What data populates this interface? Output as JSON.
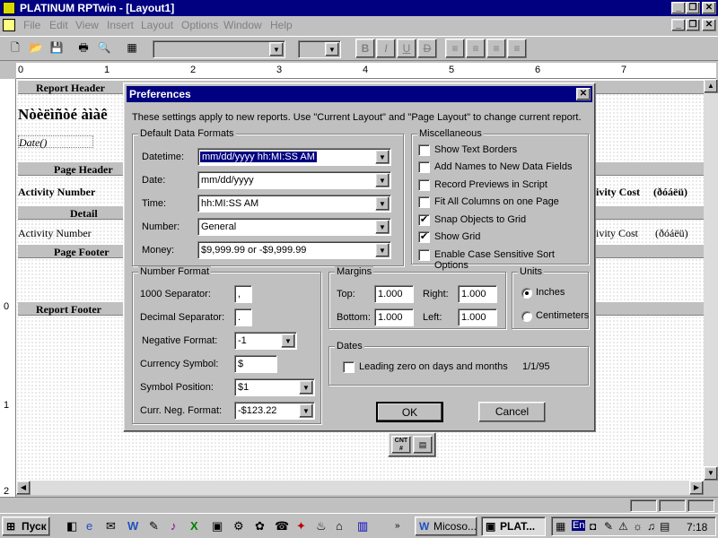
{
  "window": {
    "title": "PLATINUM RPTwin - [Layout1]"
  },
  "menu": [
    "File",
    "Edit",
    "View",
    "Insert",
    "Layout",
    "Options",
    "Window",
    "Help"
  ],
  "toolbar": {
    "bold": "B",
    "italic": "I",
    "underline": "U",
    "strike": "D"
  },
  "ruler": [
    "0",
    "1",
    "2",
    "3",
    "4",
    "5",
    "6",
    "7"
  ],
  "vruler": [
    "0",
    "1",
    "2"
  ],
  "report": {
    "header_band": "Report Header",
    "header_title": "Nòèëìñòé àìàê",
    "date_field": "Date()",
    "page_header_band": "Page Header",
    "col1": "Activity Number",
    "col_right": "ivity Cost",
    "col_right_extra": "(ðóáëü)",
    "detail_band": "Detail",
    "detail_col1": "Activity Number",
    "detail_col_right": "ivity Cost",
    "detail_col_right_extra": "(ðóáëü)",
    "page_footer_band": "Page Footer",
    "report_footer_band": "Report Footer"
  },
  "floating": {
    "cnt": "CNT #"
  },
  "dialog": {
    "title": "Preferences",
    "intro": "These settings apply to new reports.  Use \"Current Layout\" and \"Page Layout\" to change current report.",
    "ddf": {
      "legend": "Default Data Formats",
      "datetime_label": "Datetime:",
      "datetime": "mm/dd/yyyy hh:MI:SS AM",
      "date_label": "Date:",
      "date": "mm/dd/yyyy",
      "time_label": "Time:",
      "time": "hh:MI:SS AM",
      "number_label": "Number:",
      "number": "General",
      "money_label": "Money:",
      "money": "$9,999.99 or -$9,999.99"
    },
    "misc": {
      "legend": "Miscellaneous",
      "items": [
        {
          "label": "Show Text Borders",
          "checked": false
        },
        {
          "label": "Add Names to New Data Fields",
          "checked": false
        },
        {
          "label": "Record Previews in Script",
          "checked": false
        },
        {
          "label": "Fit All Columns on one Page",
          "checked": false
        },
        {
          "label": "Snap Objects to Grid",
          "checked": true
        },
        {
          "label": "Show Grid",
          "checked": true
        },
        {
          "label": "Enable Case Sensitive Sort Options",
          "checked": false
        }
      ]
    },
    "numfmt": {
      "legend": "Number Format",
      "sep_label": "1000 Separator:",
      "sep": ",",
      "dec_label": "Decimal Separator:",
      "dec": ".",
      "neg_label": "Negative Format:",
      "neg": "-1",
      "cur_label": "Currency Symbol:",
      "cur": "$",
      "pos_label": "Symbol Position:",
      "pos": "$1",
      "curneg_label": "Curr. Neg. Format:",
      "curneg": "-$123.22"
    },
    "margins": {
      "legend": "Margins",
      "top_label": "Top:",
      "top": "1.000",
      "right_label": "Right:",
      "right": "1.000",
      "bottom_label": "Bottom:",
      "bottom": "1.000",
      "left_label": "Left:",
      "left": "1.000"
    },
    "units": {
      "legend": "Units",
      "inches": "Inches",
      "cm": "Centimeters",
      "selected": "inches"
    },
    "dates": {
      "legend": "Dates",
      "leading_zero": "Leading zero on days and months",
      "sample": "1/1/95"
    },
    "ok": "OK",
    "cancel": "Cancel"
  },
  "taskbar": {
    "start": "Пуск",
    "tasks": [
      "Micoso...",
      "PLAT..."
    ],
    "lang": "En",
    "clock": "7:18"
  },
  "colors": {
    "titlebar": "#000080",
    "face": "#c0c0c0"
  }
}
